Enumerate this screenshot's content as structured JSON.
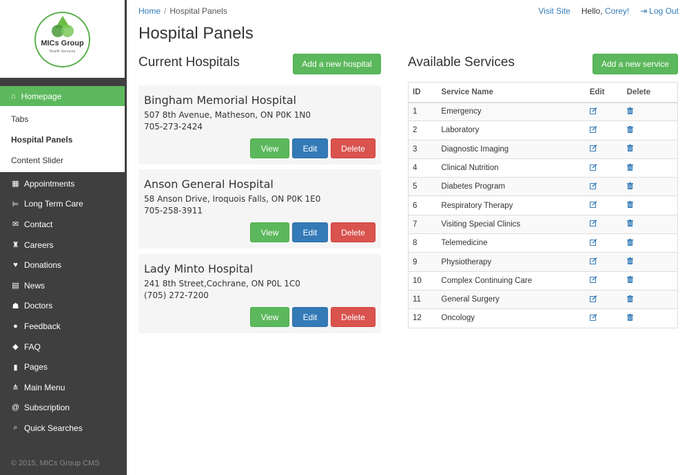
{
  "logo": {
    "name": "MICs Group",
    "subtitle": "Health Services"
  },
  "sidebar": {
    "home": {
      "label": "Homepage",
      "icon": "home-icon"
    },
    "subitems": [
      {
        "label": "Tabs",
        "active": false
      },
      {
        "label": "Hospital Panels",
        "active": true
      },
      {
        "label": "Content Slider",
        "active": false
      }
    ],
    "items": [
      {
        "label": "Appointments",
        "icon": "calendar-icon",
        "glyph": "▦"
      },
      {
        "label": "Long Term Care",
        "icon": "bed-icon",
        "glyph": "⊨"
      },
      {
        "label": "Contact",
        "icon": "envelope-icon",
        "glyph": "✉"
      },
      {
        "label": "Careers",
        "icon": "graduation-cap-icon",
        "glyph": "♜"
      },
      {
        "label": "Donations",
        "icon": "heart-icon",
        "glyph": "♥"
      },
      {
        "label": "News",
        "icon": "newspaper-icon",
        "glyph": "▤"
      },
      {
        "label": "Doctors",
        "icon": "user-md-icon",
        "glyph": "☗"
      },
      {
        "label": "Feedback",
        "icon": "comment-icon",
        "glyph": "●"
      },
      {
        "label": "FAQ",
        "icon": "comments-icon",
        "glyph": "◆"
      },
      {
        "label": "Pages",
        "icon": "file-icon",
        "glyph": "▮"
      },
      {
        "label": "Main Menu",
        "icon": "sitemap-icon",
        "glyph": "⋔"
      },
      {
        "label": "Subscription",
        "icon": "at-icon",
        "glyph": "@"
      },
      {
        "label": "Quick Searches",
        "icon": "search-icon",
        "glyph": "⌕"
      }
    ],
    "footer": "© 2015, MICs Group CMS"
  },
  "breadcrumb": {
    "home": "Home",
    "current": "Hospital Panels"
  },
  "topbar": {
    "visit_site": "Visit Site",
    "hello": "Hello,",
    "user": "Corey!",
    "logout": "Log Out"
  },
  "page_title": "Hospital Panels",
  "hospitals": {
    "title": "Current Hospitals",
    "add_label": "Add a new hospital",
    "view_label": "View",
    "edit_label": "Edit",
    "delete_label": "Delete",
    "items": [
      {
        "name": "Bingham Memorial Hospital",
        "address": "507 8th Avenue, Matheson, ON P0K 1N0",
        "phone": "705-273-2424"
      },
      {
        "name": "Anson General Hospital",
        "address": "58 Anson Drive, Iroquois Falls, ON P0K 1E0",
        "phone": "705-258-3911"
      },
      {
        "name": "Lady Minto Hospital",
        "address": "241 8th Street,Cochrane, ON P0L 1C0",
        "phone": "(705) 272-7200"
      }
    ]
  },
  "services": {
    "title": "Available Services",
    "add_label": "Add a new service",
    "columns": [
      "ID",
      "Service Name",
      "Edit",
      "Delete"
    ],
    "rows": [
      {
        "id": "1",
        "name": "Emergency"
      },
      {
        "id": "2",
        "name": "Laboratory"
      },
      {
        "id": "3",
        "name": "Diagnostic Imaging"
      },
      {
        "id": "4",
        "name": "Clinical Nutrition"
      },
      {
        "id": "5",
        "name": "Diabetes Program"
      },
      {
        "id": "6",
        "name": "Respiratory Therapy"
      },
      {
        "id": "7",
        "name": "Visiting Special Clinics"
      },
      {
        "id": "8",
        "name": "Telemedicine"
      },
      {
        "id": "9",
        "name": "Physiotherapy"
      },
      {
        "id": "10",
        "name": "Complex Continuing Care"
      },
      {
        "id": "11",
        "name": "General Surgery"
      },
      {
        "id": "12",
        "name": "Oncology"
      }
    ]
  },
  "colors": {
    "brand_green": "#5cb85c",
    "primary_blue": "#337ab7",
    "danger_red": "#d9534f",
    "sidebar_bg": "#3f3f3f"
  }
}
